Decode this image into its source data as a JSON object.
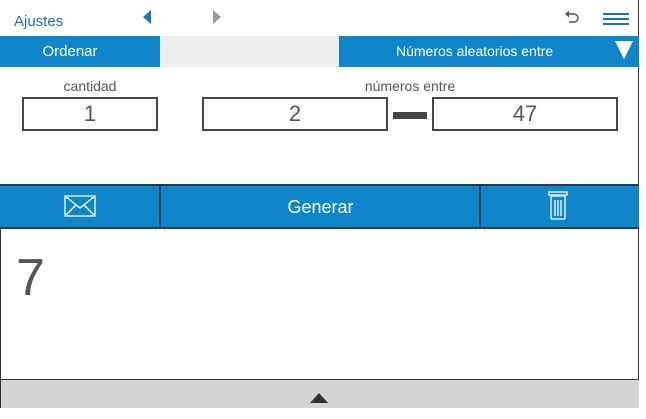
{
  "header": {
    "settings_label": "Ajustes",
    "icons": [
      "chevron-left-icon",
      "chevron-right-icon",
      "undo-icon",
      "menu-icon"
    ]
  },
  "options": {
    "sort_label": "Ordenar",
    "mode_label": "Números aleatorios entre"
  },
  "inputs": {
    "quantity_label": "cantidad",
    "quantity_value": "1",
    "range_label": "números entre",
    "range_min": "2",
    "range_max": "47"
  },
  "actions": {
    "generate_label": "Generar"
  },
  "result": {
    "value": "7"
  },
  "colors": {
    "accent": "#0e86c9",
    "link": "#1f6fb5",
    "border": "#444444"
  }
}
